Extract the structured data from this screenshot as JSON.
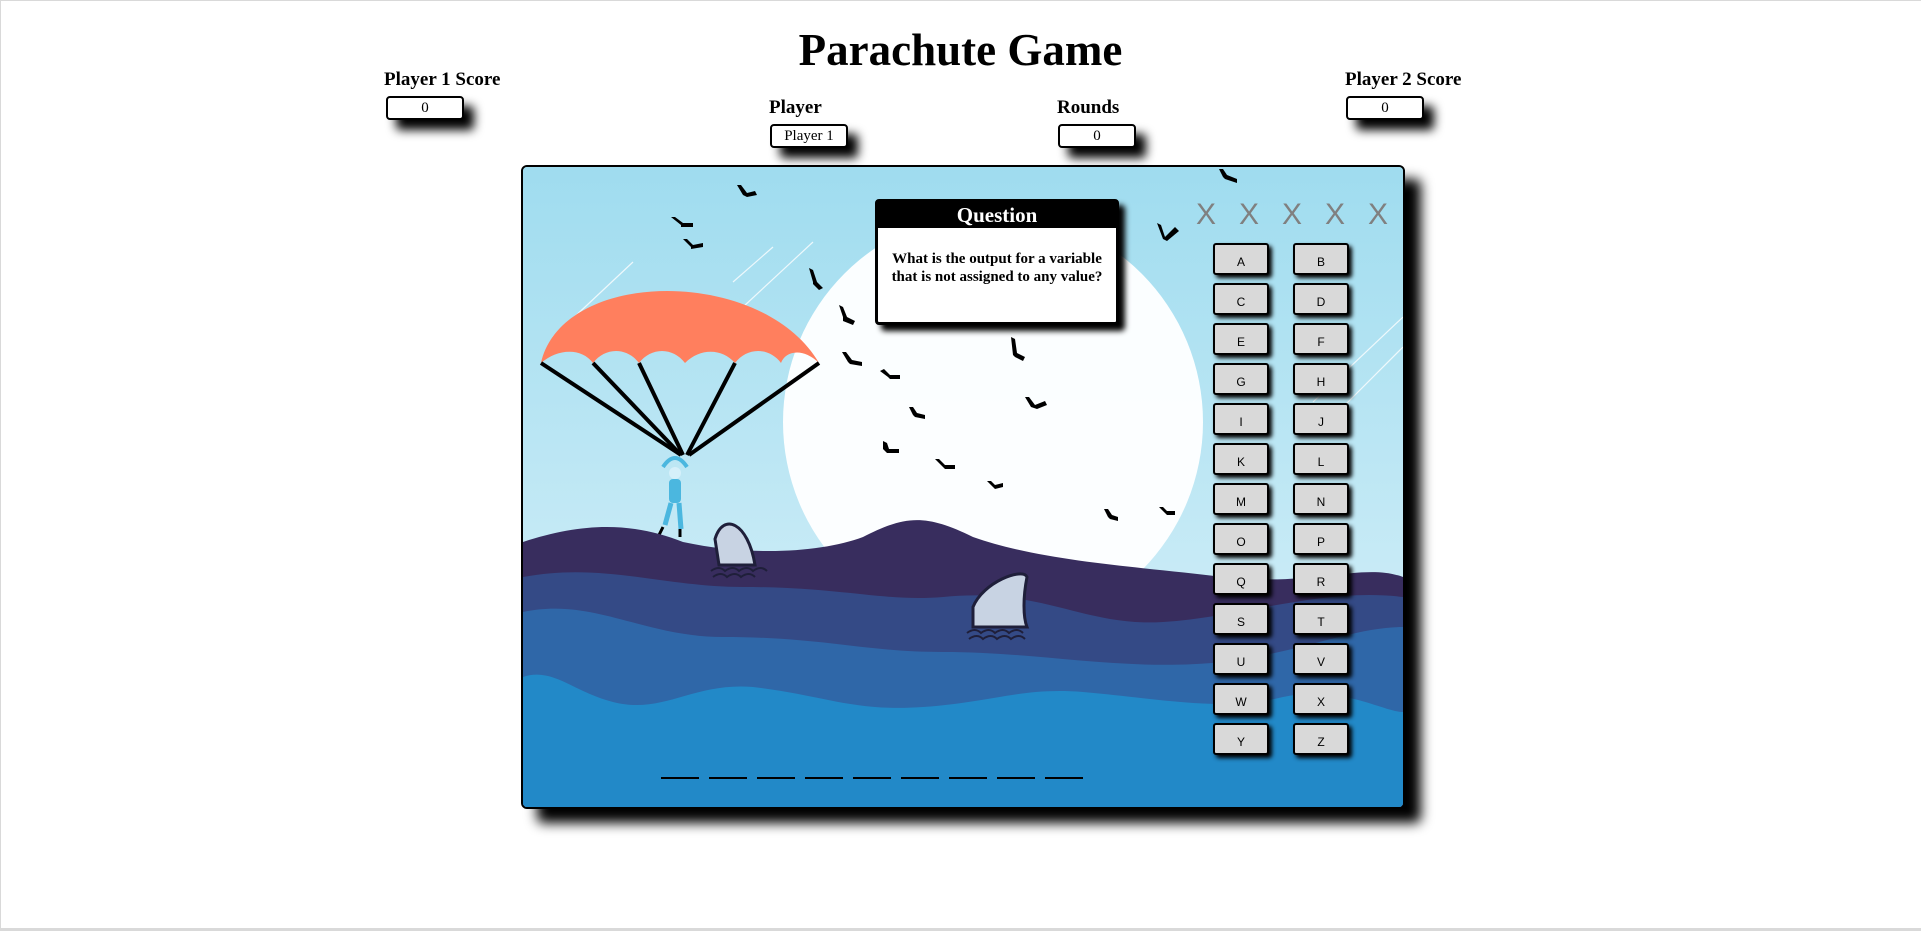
{
  "page": {
    "title": "Parachute Game"
  },
  "scores": {
    "player1": {
      "label": "Player 1 Score",
      "value": "0"
    },
    "player2": {
      "label": "Player 2 Score",
      "value": "0"
    }
  },
  "player": {
    "label": "Player",
    "value": "Player 1"
  },
  "rounds": {
    "label": "Rounds",
    "value": "0"
  },
  "question": {
    "header": "Question",
    "text": "What is the output for a variable that is not assigned to any value?"
  },
  "strikes": [
    "X",
    "X",
    "X",
    "X",
    "X"
  ],
  "letters": [
    "A",
    "B",
    "C",
    "D",
    "E",
    "F",
    "G",
    "H",
    "I",
    "J",
    "K",
    "L",
    "M",
    "N",
    "O",
    "P",
    "Q",
    "R",
    "S",
    "T",
    "U",
    "V",
    "W",
    "X",
    "Y",
    "Z"
  ],
  "answer_blanks": 9,
  "colors": {
    "sky": "#a6e0f0",
    "sun": "#ffffff",
    "parachute": "#ff7f5e",
    "wave_dark": "#382d5e",
    "wave_mid": "#344a86",
    "wave_blue": "#2f67a8",
    "sea": "#2289c8",
    "fin": "#c8d3e3",
    "button": "#d9d9d9",
    "strike": "#808080"
  }
}
